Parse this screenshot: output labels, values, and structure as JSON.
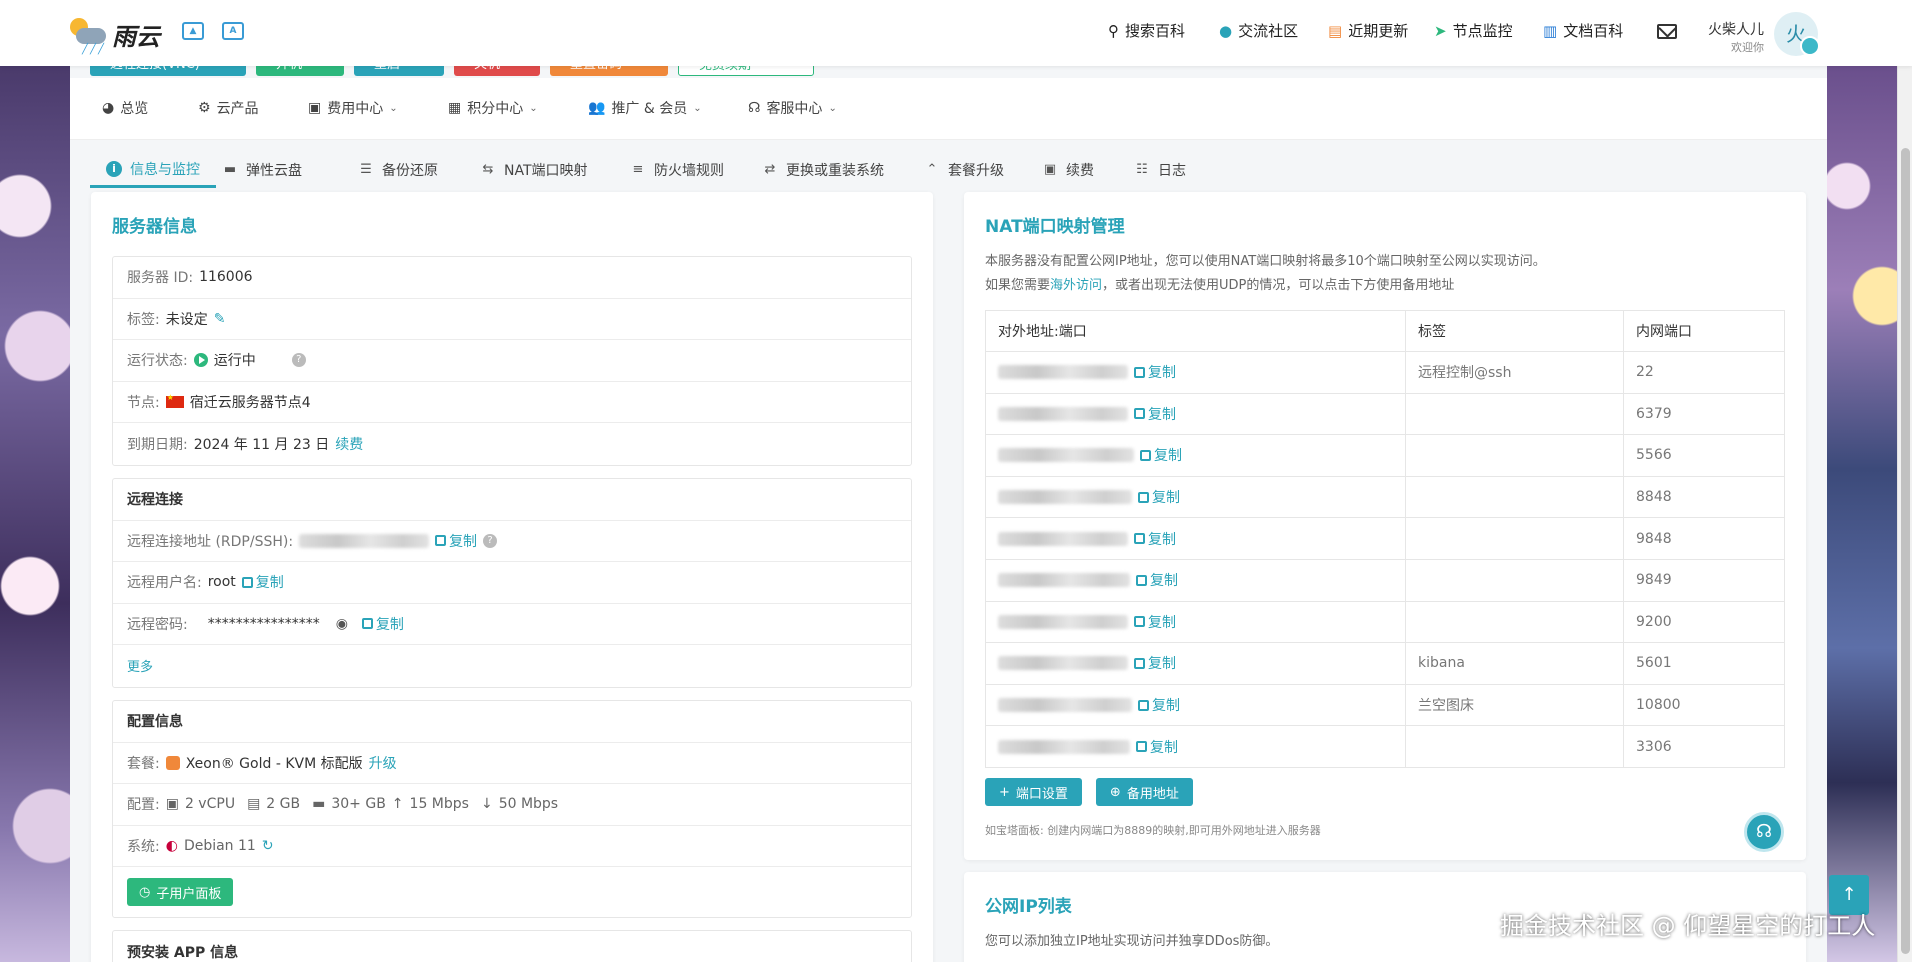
{
  "header": {
    "logo_text": "雨云",
    "nav": [
      {
        "icon": "search-icon",
        "label": "搜索百科"
      },
      {
        "icon": "community-icon",
        "label": "交流社区"
      },
      {
        "icon": "update-icon",
        "label": "近期更新"
      },
      {
        "icon": "monitor-icon",
        "label": "节点监控"
      },
      {
        "icon": "book-icon",
        "label": "文档百科"
      }
    ],
    "user": {
      "name": "火柴人儿",
      "greeting": "欢迎你",
      "avatar_char": "火"
    }
  },
  "action_buttons": [
    {
      "label": "远程连接(VNC)",
      "color": "#2aa3b8"
    },
    {
      "label": "开机",
      "color": "#2db87d"
    },
    {
      "label": "重启",
      "color": "#2aa3b8"
    },
    {
      "label": "关机",
      "color": "#e04b4b"
    },
    {
      "label": "重置密码",
      "color": "#f0883a"
    },
    {
      "label": "免费续期",
      "color": "#2db87d"
    }
  ],
  "nav2": [
    {
      "label": "总览",
      "icon": "dashboard-icon",
      "dropdown": false
    },
    {
      "label": "云产品",
      "icon": "cloud-products-icon",
      "dropdown": false
    },
    {
      "label": "费用中心",
      "icon": "billing-icon",
      "dropdown": true
    },
    {
      "label": "积分中心",
      "icon": "gift-icon",
      "dropdown": true
    },
    {
      "label": "推广 & 会员",
      "icon": "users-icon",
      "dropdown": true
    },
    {
      "label": "客服中心",
      "icon": "headset-icon",
      "dropdown": true
    }
  ],
  "tabs": [
    {
      "label": "信息与监控",
      "icon": "info-icon",
      "active": true
    },
    {
      "label": "弹性云盘",
      "icon": "disk-icon"
    },
    {
      "label": "备份还原",
      "icon": "backup-icon"
    },
    {
      "label": "NAT端口映射",
      "icon": "nat-icon"
    },
    {
      "label": "防火墙规则",
      "icon": "firewall-icon"
    },
    {
      "label": "更换或重装系统",
      "icon": "swap-icon"
    },
    {
      "label": "套餐升级",
      "icon": "upgrade-icon"
    },
    {
      "label": "续费",
      "icon": "renew-icon"
    },
    {
      "label": "日志",
      "icon": "log-icon"
    }
  ],
  "server_info": {
    "title": "服务器信息",
    "id_label": "服务器 ID:",
    "id_value": "116006",
    "tag_label": "标签:",
    "tag_value": "未设定",
    "status_label": "运行状态:",
    "status_value": "运行中",
    "node_label": "节点:",
    "node_value": "宿迁云服务器节点4",
    "expire_label": "到期日期:",
    "expire_value": "2024 年 11 月 23 日",
    "renew_link": "续费"
  },
  "remote": {
    "heading": "远程连接",
    "addr_label": "远程连接地址 (RDP/SSH):",
    "user_label": "远程用户名:",
    "user_value": "root",
    "pwd_label": "远程密码:",
    "pwd_value": "****************",
    "copy_label": "复制",
    "more": "更多"
  },
  "config": {
    "heading": "配置信息",
    "plan_label": "套餐:",
    "plan_value": "Xeon® Gold - KVM 标配版",
    "upgrade_link": "升级",
    "spec_label": "配置:",
    "cpu": "2 vCPU",
    "ram": "2 GB",
    "disk": "30+ GB",
    "up": "15 Mbps",
    "down": "50 Mbps",
    "os_label": "系统:",
    "os_value": "Debian 11",
    "panel_button": "子用户面板"
  },
  "preinstall": {
    "heading": "预安装 APP 信息"
  },
  "nat": {
    "title": "NAT端口映射管理",
    "desc1": "本服务器没有配置公网IP地址，您可以使用NAT端口映射将最多10个端口映射至公网以实现访问。",
    "desc2_pre": "如果您需要",
    "desc2_link": "海外访问",
    "desc2_post": "，或者出现无法使用UDP的情况，可以点击下方使用备用地址",
    "columns": [
      "对外地址:端口",
      "标签",
      "内网端口"
    ],
    "copy_label": "复制",
    "rows": [
      {
        "tag": "远程控制@ssh",
        "port": "22"
      },
      {
        "tag": "",
        "port": "6379"
      },
      {
        "tag": "",
        "port": "5566"
      },
      {
        "tag": "",
        "port": "8848"
      },
      {
        "tag": "",
        "port": "9848"
      },
      {
        "tag": "",
        "port": "9849"
      },
      {
        "tag": "",
        "port": "9200"
      },
      {
        "tag": "kibana",
        "port": "5601"
      },
      {
        "tag": "兰空图床",
        "port": "10800"
      },
      {
        "tag": "",
        "port": "3306"
      }
    ],
    "btn_port": "端口设置",
    "btn_backup": "备用地址",
    "hint": "如宝塔面板: 创建内网端口为8889的映射,即可用外网地址进入服务器"
  },
  "public_ip": {
    "title": "公网IP列表",
    "desc": "您可以添加独立IP地址实现访问并独享DDos防御。"
  },
  "watermark": "掘金技术社区 @ 仰望星空的打工人"
}
